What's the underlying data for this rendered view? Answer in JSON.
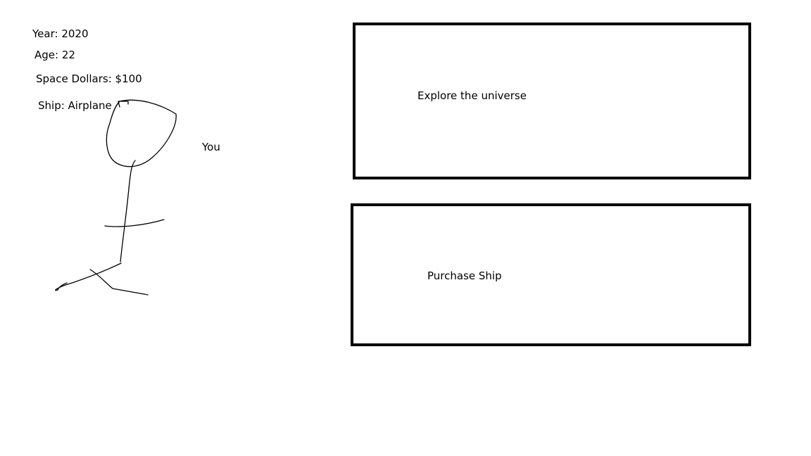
{
  "stats": {
    "year": "Year: 2020",
    "age": "Age: 22",
    "space_dollars": "Space Dollars: $100",
    "ship": "Ship: Airplane"
  },
  "player": {
    "label": "You"
  },
  "actions": {
    "explore_label": "Explore the universe",
    "purchase_label": "Purchase Ship"
  },
  "colors": {
    "ink": "#000000",
    "background": "#ffffff"
  }
}
